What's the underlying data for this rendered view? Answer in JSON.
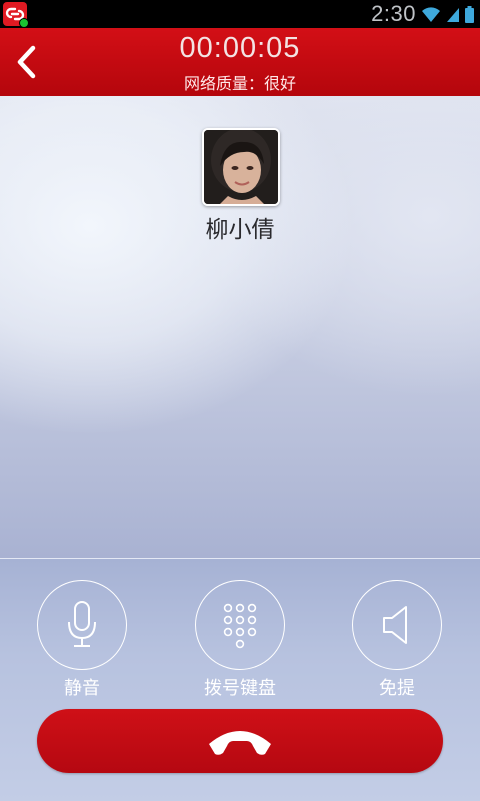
{
  "status_bar": {
    "time": "2:30",
    "icons": [
      "app-notification-icon",
      "wifi-icon",
      "signal-icon",
      "battery-icon"
    ]
  },
  "header": {
    "timer": "00:00:05",
    "quality": "网络质量：很好"
  },
  "contact": {
    "name": "柳小倩"
  },
  "controls": {
    "mute_label": "静音",
    "keypad_label": "拨号键盘",
    "speaker_label": "免提"
  },
  "colors": {
    "brand_red": "#c80a12",
    "status_bar": "#000000",
    "accent_green": "#19c231"
  }
}
